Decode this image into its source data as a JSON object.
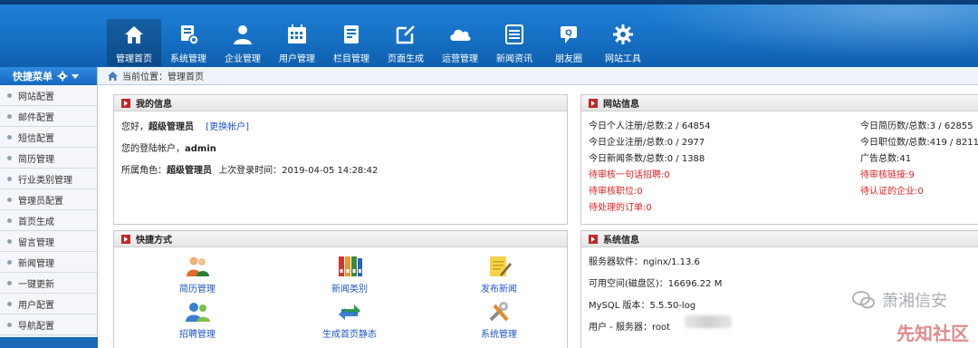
{
  "nav": [
    {
      "label": "管理首页",
      "icon": "home-icon"
    },
    {
      "label": "系统管理",
      "icon": "system-icon"
    },
    {
      "label": "企业管理",
      "icon": "user-icon"
    },
    {
      "label": "用户管理",
      "icon": "calendar-icon"
    },
    {
      "label": "栏目管理",
      "icon": "document-icon"
    },
    {
      "label": "页面生成",
      "icon": "edit-icon"
    },
    {
      "label": "运营管理",
      "icon": "cloud-icon"
    },
    {
      "label": "新闻资讯",
      "icon": "list-icon"
    },
    {
      "label": "朋友圈",
      "icon": "chat-icon"
    },
    {
      "label": "网站工具",
      "icon": "gear-icon"
    }
  ],
  "location": {
    "text": "当前位置：管理首页"
  },
  "sidebar": {
    "title": "快捷菜单",
    "items": [
      "网站配置",
      "邮件配置",
      "短信配置",
      "简历管理",
      "行业类别管理",
      "管理员配置",
      "首页生成",
      "留言管理",
      "新闻管理",
      "一键更新",
      "用户配置",
      "导航配置"
    ]
  },
  "my_info": {
    "title": "我的信息",
    "greeting": "您好，",
    "role_name": "超级管理员",
    "switch_account": "[更换帐户]",
    "login_account_label": "您的登陆帐户，",
    "login_account": "admin",
    "role_label": "所属角色：",
    "role": "超级管理员",
    "last_login": "上次登录时间：2019-04-05 14:28:42"
  },
  "site_info": {
    "title": "网站信息",
    "personal_reg": "今日个人注册/总数:2 / 64854",
    "company_reg": "今日企业注册/总数:0 / 2977",
    "news": "今日新闻条数/总数:0 / 1388",
    "pending_recruit": "待审核一句话招聘:0",
    "pending_job": "待审核职位:0",
    "pending_order": "待处理的订单:0",
    "resume": "今日简历数/总数:3 / 62855",
    "jobs": "今日职位数/总数:419 / 8211",
    "ads": "广告总数:41",
    "pending_links": "待审核链接:9",
    "pending_company": "待认证的企业:0"
  },
  "quick": {
    "title": "快捷方式",
    "items": [
      {
        "label": "简历管理",
        "icon": "people-icon"
      },
      {
        "label": "新闻类别",
        "icon": "binders-icon"
      },
      {
        "label": "发布新闻",
        "icon": "note-pencil-icon"
      },
      {
        "label": "招聘管理",
        "icon": "users-icon"
      },
      {
        "label": "生成首页静态",
        "icon": "refresh-arrows-icon"
      },
      {
        "label": "系统管理",
        "icon": "tools-icon"
      }
    ]
  },
  "sys_info": {
    "title": "系统信息",
    "server": "服务器软件：nginx/1.13.6",
    "space": "可用空间(磁盘区)：16696.22 M",
    "mysql": "MySQL 版本：5.5.50-log",
    "user": "用户 - 服务器：root"
  },
  "watermark": {
    "text1": "萧湘信安",
    "text2": "先知社区"
  },
  "colors": {
    "header": "#1670c4",
    "accent_red": "#c1272d",
    "link": "#1f56c8",
    "alert": "#e02020"
  }
}
